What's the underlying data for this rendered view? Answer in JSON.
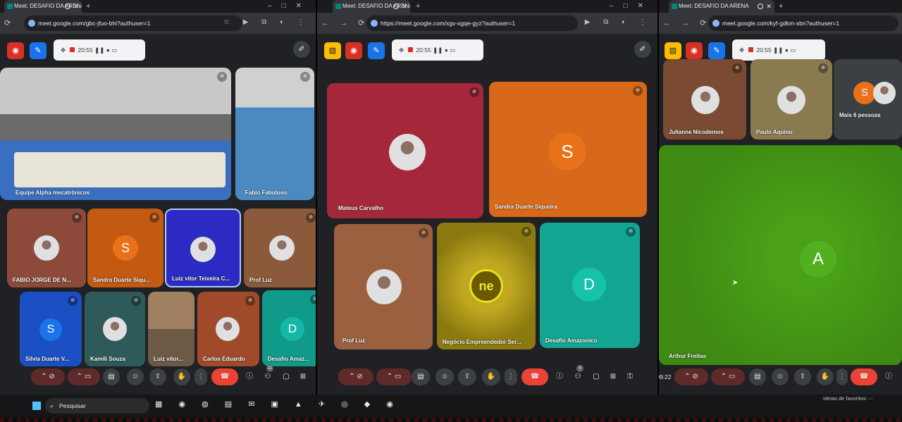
{
  "windows": [
    {
      "tab_title": "Meet: DESAFIO DA ARENA",
      "url": "meet.google.com/gbc-jfuo-bhi?authuser=1",
      "timer": "20:55",
      "featured": [
        {
          "name": "Equipe Alpha mecatrônicos"
        },
        {
          "name": "Fabio Fabuloso"
        }
      ],
      "tiles": [
        {
          "name": "FABIO JORGE DE N...",
          "color": "#8d4a3a"
        },
        {
          "name": "Sandra Duarte Siqu...",
          "color": "#c25a12",
          "initial": "S"
        },
        {
          "name": "Luiz vitor Teixeira C...",
          "color": "#2b2bc4"
        },
        {
          "name": "Prof Luz",
          "color": "#8a5a3a"
        },
        {
          "name": "Silvia Duarte V...",
          "color": "#1b4fc4",
          "initial": "S"
        },
        {
          "name": "Kamili Souza",
          "color": "#2f5a5a"
        },
        {
          "name": "Luiz vitor...",
          "color": "#6d5a46"
        },
        {
          "name": "Carlos Eduardo",
          "color": "#a04a2a"
        },
        {
          "name": "Desafio Amaz...",
          "color": "#109a8a",
          "initial": "D"
        }
      ],
      "participants_badge": "11"
    },
    {
      "tab_title": "Meet: DESAFIO DA ARENA",
      "url": "https://meet.google.com/xgv-xgqe-gyz?authuser=1",
      "timer": "20:55",
      "tiles": [
        {
          "name": "Mateus Carvalho",
          "color": "#a4283a"
        },
        {
          "name": "Sandra Duarte Siqueira",
          "color": "#d8681a",
          "initial": "S"
        },
        {
          "name": "Prof Luz",
          "color": "#9a6040"
        },
        {
          "name": "Negócio Empreendedor Ser...",
          "color": "#8c7a10",
          "initial": "ne"
        },
        {
          "name": "Desafio Amazonico",
          "color": "#12a592",
          "initial": "D"
        }
      ],
      "participants_badge": "6"
    },
    {
      "tab_title": "Meet: DESAFIO DA ARENA",
      "url": "meet.google.com/kyf-gdkm-xbn?authuser=1",
      "timer": "20:55",
      "strip": [
        {
          "name": "Julianne Nicodemos",
          "color": "#7a4a32"
        },
        {
          "name": "Paulo Aquino",
          "color": "#8a7a50"
        },
        {
          "name": "Mais 6 pessoas",
          "color": "#3c4043",
          "initial": "S"
        }
      ],
      "main": {
        "name": "Arthur Freitas",
        "initial": "A",
        "color": "#3e9a10"
      },
      "clock": "09:22"
    }
  ],
  "taskbar": {
    "search_placeholder": "Pesquisar",
    "favorites": "Ideias de favoritos"
  },
  "colors": {
    "meet_red": "#ea4335",
    "accent_blue": "#1a73e8"
  }
}
